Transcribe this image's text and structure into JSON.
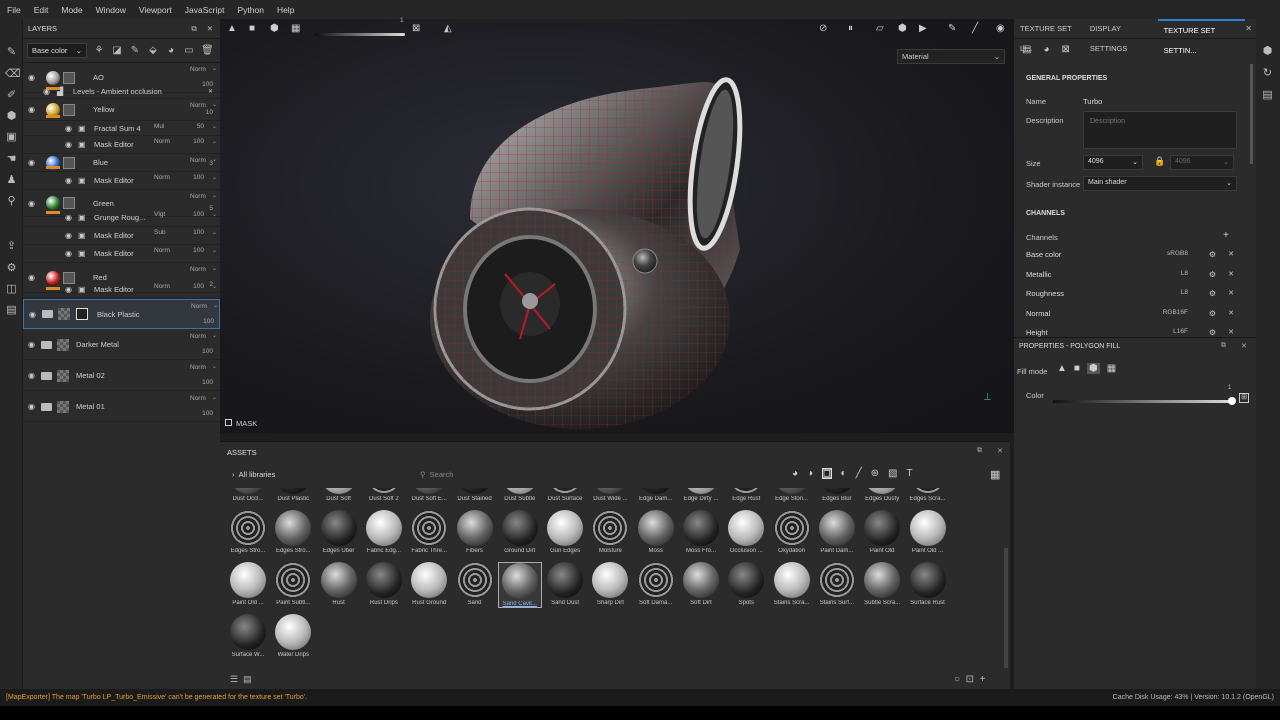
{
  "menu": [
    "File",
    "Edit",
    "Mode",
    "Window",
    "Viewport",
    "JavaScript",
    "Python",
    "Help"
  ],
  "layers_panel": {
    "title": "LAYERS",
    "channel_select": "Base color",
    "rows": [
      {
        "name": "AO",
        "blend": "Norm",
        "opacity": "100",
        "color": "#9a9a9a",
        "type": "fill"
      },
      {
        "name": "Levels - Ambient occlusion",
        "type": "effect"
      },
      {
        "name": "Yellow",
        "blend": "Norm",
        "opacity": "10",
        "color": "#c8a220",
        "type": "fill"
      },
      {
        "name": "Fractal Sum 4",
        "blend": "Mul",
        "opacity": "50",
        "type": "effect"
      },
      {
        "name": "Mask Editor",
        "blend": "Norm",
        "opacity": "100",
        "type": "effect"
      },
      {
        "name": "Blue",
        "blend": "Norm",
        "opacity": "3",
        "color": "#2a66c8",
        "type": "fill"
      },
      {
        "name": "Mask Editor",
        "blend": "Norm",
        "opacity": "100",
        "type": "effect"
      },
      {
        "name": "Green",
        "blend": "Norm",
        "opacity": "5",
        "color": "#2a7a2a",
        "type": "fill"
      },
      {
        "name": "Grunge Roug...",
        "blend": "Vlgt",
        "opacity": "100",
        "type": "effect"
      },
      {
        "name": "Mask Editor",
        "blend": "Sub",
        "opacity": "100",
        "type": "effect"
      },
      {
        "name": "Mask Editor",
        "blend": "Norm",
        "opacity": "100",
        "type": "effect"
      },
      {
        "name": "Red",
        "blend": "Norm",
        "opacity": "2",
        "color": "#c82020",
        "type": "fill"
      },
      {
        "name": "Mask Editor",
        "blend": "Norm",
        "opacity": "100",
        "type": "effect"
      },
      {
        "name": "Black Plastic",
        "blend": "Norm",
        "opacity": "100",
        "type": "folder",
        "selected": true
      },
      {
        "name": "Darker Metal",
        "blend": "Norm",
        "opacity": "100",
        "type": "folder"
      },
      {
        "name": "Metal 02",
        "blend": "Norm",
        "opacity": "100",
        "type": "folder"
      },
      {
        "name": "Metal 01",
        "blend": "Norm",
        "opacity": "100",
        "type": "folder"
      }
    ]
  },
  "viewport": {
    "material_select": "Material",
    "mask_label": "MASK",
    "toolbar_value": "1"
  },
  "assets": {
    "title": "ASSETS",
    "library": "All libraries",
    "search_placeholder": "Search",
    "rows": [
      [
        "Dust Occl...",
        "Dust Plastic",
        "Dust Soft",
        "Dust Soft 2",
        "Dust Soft E...",
        "Dust Stained",
        "Dust Subtle",
        "Dust Surface",
        "Dust Wide ...",
        "Edge Dam...",
        "Edge Dirty ...",
        "Edge Rust",
        "Edge Ston...",
        "Edges Blur",
        "Edges Dusty",
        "Edges Scra..."
      ],
      [
        "Edges Stro...",
        "Edges Stro...",
        "Edges Uber",
        "Fabric Edg...",
        "Fabric Thre...",
        "Fibers",
        "Ground Dirt",
        "Gun Edges",
        "Moisture",
        "Moss",
        "Moss Fro...",
        "Occlusion ...",
        "Oxydation",
        "Paint Dam...",
        "Paint Old",
        "Paint Old ..."
      ],
      [
        "Paint Old ...",
        "Paint Subtl...",
        "Rust",
        "Rust Drips",
        "Rust Ground",
        "Sand",
        "Sand Cavit...",
        "Sand Dust",
        "Sharp Dirt",
        "Soft Dama...",
        "Soft Dirt",
        "Spots",
        "Stains Scra...",
        "Stains Surf...",
        "Subtle Scra...",
        "Surface Rust"
      ],
      [
        "Surface W...",
        "Water Drips"
      ]
    ],
    "selected": "Sand Cavit..."
  },
  "right_panel": {
    "tabs": [
      "TEXTURE SET LI...",
      "DISPLAY SETTINGS",
      "TEXTURE SET SETTIN..."
    ],
    "general_title": "GENERAL PROPERTIES",
    "name_label": "Name",
    "name_value": "Turbo",
    "description_label": "Description",
    "description_placeholder": "Description",
    "size_label": "Size",
    "size_value": "4096",
    "size_value2": "4096",
    "shader_label": "Shader instance",
    "shader_value": "Main shader",
    "channels_title": "CHANNELS",
    "channels_label": "Channels",
    "channels": [
      {
        "name": "Base color",
        "format": "sRGB8"
      },
      {
        "name": "Metallic",
        "format": "L8"
      },
      {
        "name": "Roughness",
        "format": "L8"
      },
      {
        "name": "Normal",
        "format": "RGB16F"
      },
      {
        "name": "Height",
        "format": "L16F"
      }
    ]
  },
  "polygon_fill": {
    "title": "PROPERTIES - POLYGON FILL",
    "fill_mode_label": "Fill mode",
    "color_label": "Color",
    "color_value": "1"
  },
  "status": {
    "message": "[MapExporter] The map 'Turbo LP_Turbo_Emissive' can't be generated for the texture set 'Turbo'.",
    "cache": "Cache Disk Usage:  43% | Version: 10.1.2 (OpenGL)"
  }
}
